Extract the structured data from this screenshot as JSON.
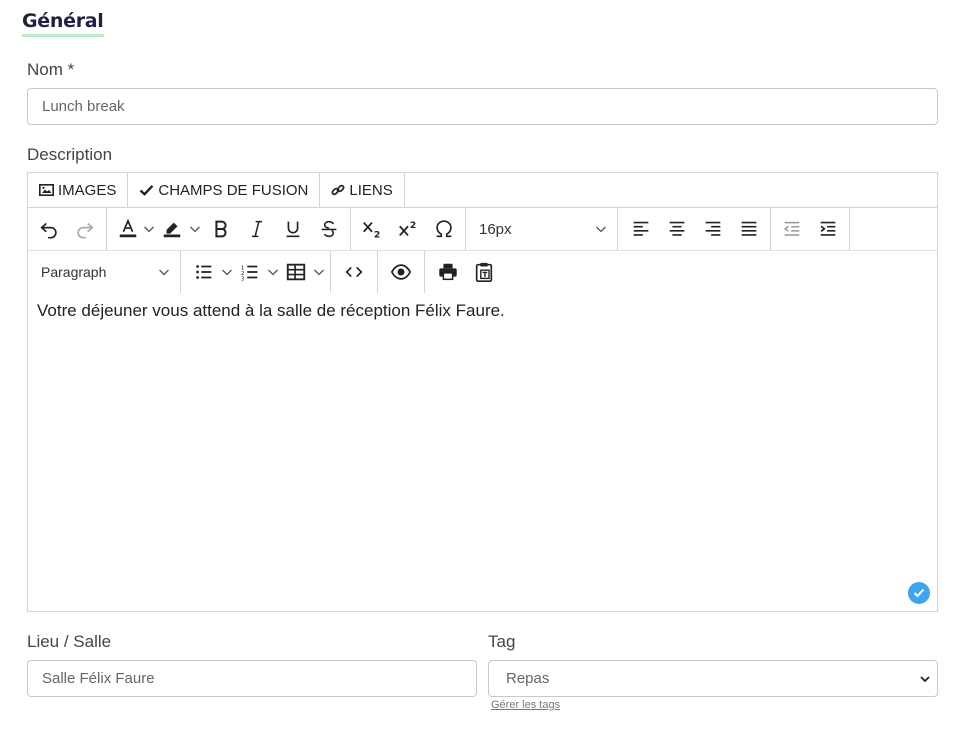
{
  "section": {
    "title": "Général"
  },
  "name_field": {
    "label": "Nom *",
    "value": "Lunch break"
  },
  "description": {
    "label": "Description",
    "tabs": [
      {
        "label": "IMAGES",
        "icon": "image-icon"
      },
      {
        "label": "CHAMPS DE FUSION",
        "icon": "check-icon"
      },
      {
        "label": "LIENS",
        "icon": "link-icon"
      }
    ],
    "font_size": "16px",
    "block_format": "Paragraph",
    "content": "Votre déjeuner vous attend à la salle de réception Félix Faure."
  },
  "location_field": {
    "label": "Lieu / Salle",
    "value": "Salle Félix Faure"
  },
  "tag_field": {
    "label": "Tag",
    "value": "Repas",
    "link": "Gérer les tags"
  },
  "colors": {
    "accent_underline": "#b9efc9",
    "badge": "#3ea4f0",
    "title": "#1b2340"
  }
}
